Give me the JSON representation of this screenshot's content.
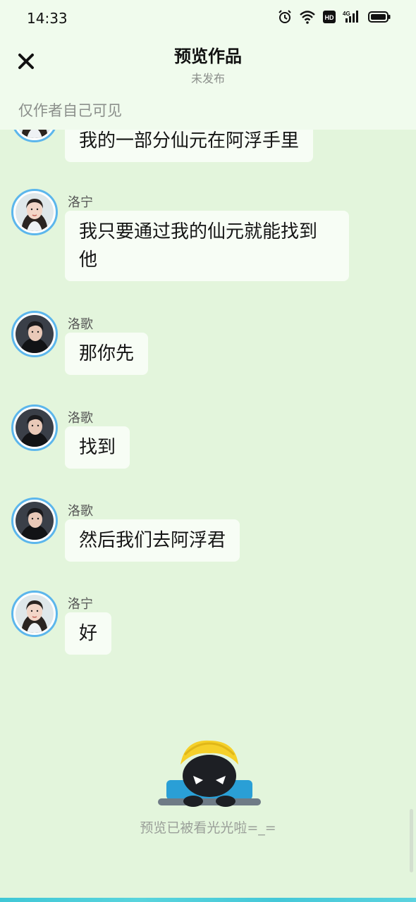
{
  "status_bar": {
    "time": "14:33",
    "icons": [
      "alarm-icon",
      "wifi-icon",
      "hd-icon",
      "4g-signal-icon",
      "battery-icon"
    ],
    "hd_label": "HD",
    "network_label": "4G"
  },
  "header": {
    "close_icon": "close-icon",
    "title": "预览作品",
    "subtitle": "未发布",
    "visibility_note": "仅作者自己可见"
  },
  "messages": [
    {
      "name": "",
      "text": "我的一部分仙元在阿浮手里",
      "avatar": "female-avatar"
    },
    {
      "name": "洛宁",
      "text": "我只要通过我的仙元就能找到他",
      "avatar": "female-avatar"
    },
    {
      "name": "洛歌",
      "text": "那你先",
      "avatar": "male-avatar"
    },
    {
      "name": "洛歌",
      "text": "找到",
      "avatar": "male-avatar"
    },
    {
      "name": "洛歌",
      "text": "然后我们去阿浮君",
      "avatar": "male-avatar"
    },
    {
      "name": "洛宁",
      "text": "好",
      "avatar": "female-avatar"
    }
  ],
  "footer": {
    "mascot_icon": "mascot-peeking-icon",
    "text": "预览已被看光光啦=_="
  },
  "colors": {
    "background": "#e3f5dc",
    "header_bg": "#f0fbed",
    "bubble_bg": "#f7fdf5",
    "avatar_ring": "#5cb6ec",
    "accent_strip": "#3fc7d6"
  }
}
